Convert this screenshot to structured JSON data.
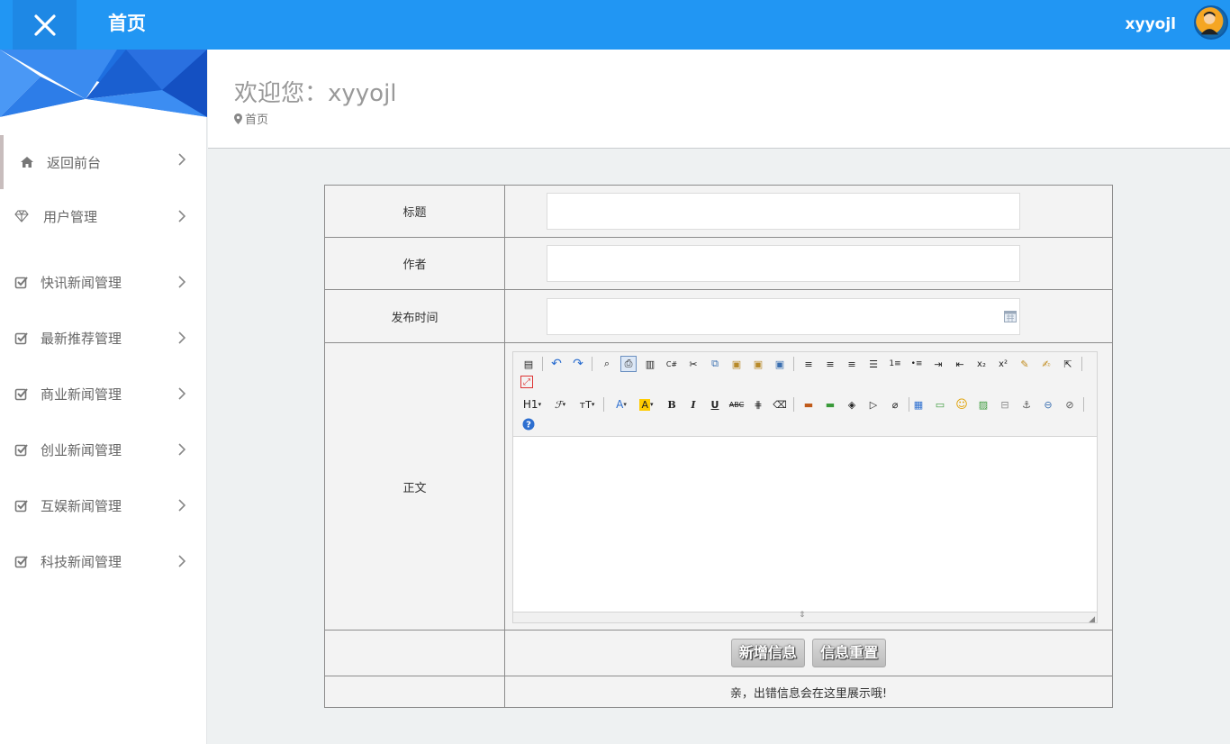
{
  "topbar": {
    "title": "首页",
    "username": "xyyojl",
    "colors": {
      "bar": "#2196f3",
      "close_bg": "#1e88e5"
    }
  },
  "sidebar": {
    "items": [
      {
        "label": "返回前台",
        "icon": "home-icon"
      },
      {
        "label": "用户管理",
        "icon": "diamond-icon"
      },
      {
        "label": "快讯新闻管理",
        "icon": "check-square-icon"
      },
      {
        "label": "最新推荐管理",
        "icon": "check-square-icon"
      },
      {
        "label": "商业新闻管理",
        "icon": "check-square-icon"
      },
      {
        "label": "创业新闻管理",
        "icon": "check-square-icon"
      },
      {
        "label": "互娱新闻管理",
        "icon": "check-square-icon"
      },
      {
        "label": "科技新闻管理",
        "icon": "check-square-icon"
      }
    ]
  },
  "header": {
    "welcome": "欢迎您：xyyojl",
    "breadcrumb": "首页"
  },
  "form": {
    "title_label": "标题",
    "title_value": "",
    "author_label": "作者",
    "author_value": "",
    "date_label": "发布时间",
    "date_value": "",
    "body_label": "正文",
    "body_value": "",
    "submit_label": "新增信息",
    "reset_label": "信息重置",
    "message": "亲，出错信息会在这里展示哦!"
  },
  "editor_toolbar": {
    "heading_label": "H1",
    "bold_label": "B",
    "italic_label": "I",
    "underline_label": "U",
    "strike_label": "ABC",
    "sub_label": "x₂",
    "sup_label": "x²"
  }
}
